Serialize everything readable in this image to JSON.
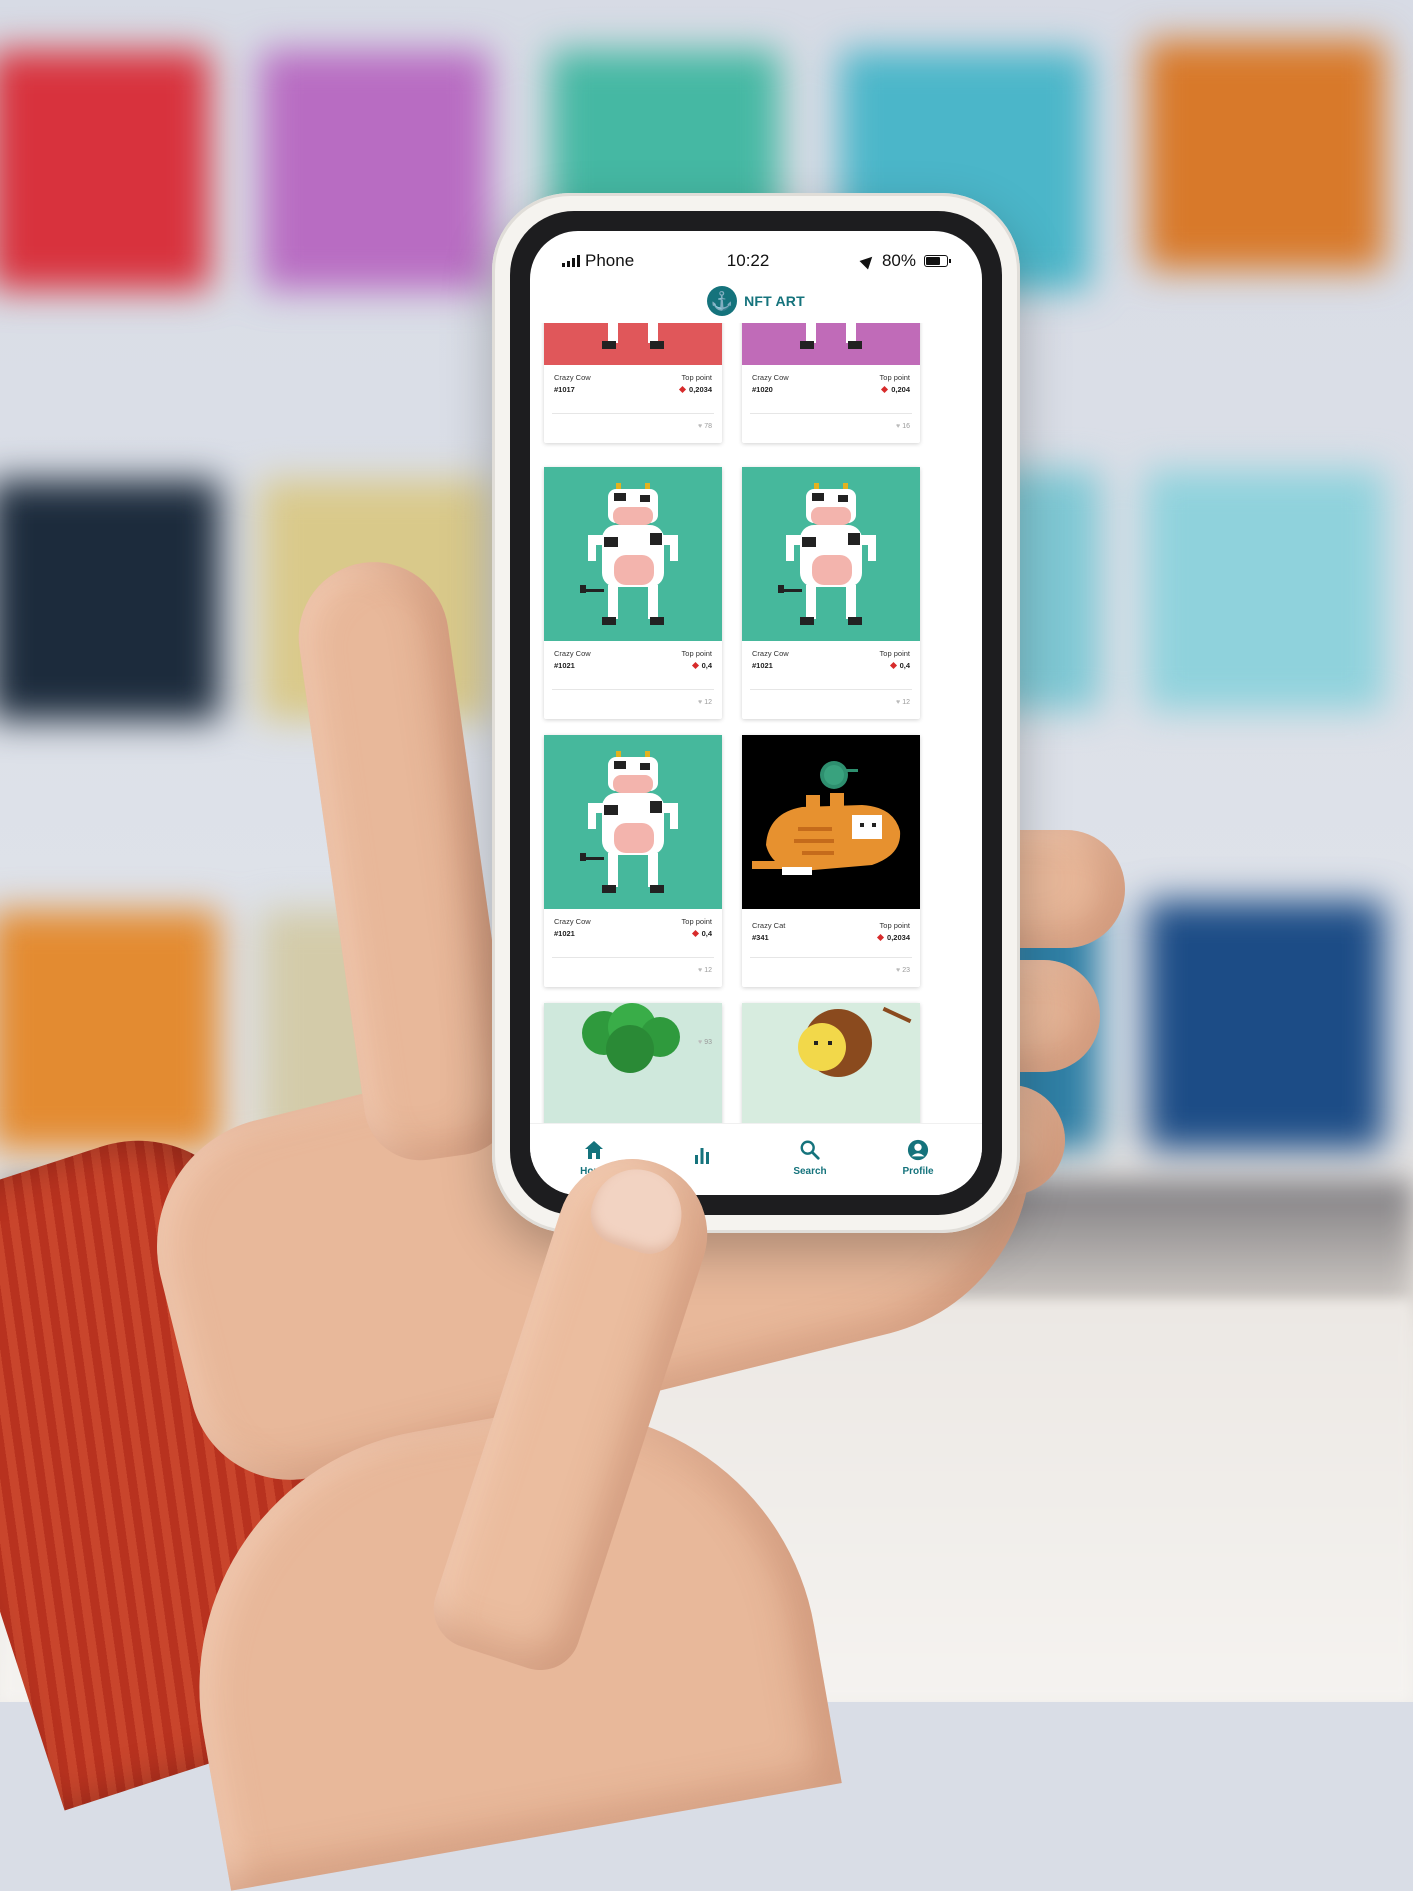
{
  "status_bar": {
    "carrier": "Phone",
    "time": "10:22",
    "battery": "80%",
    "battery_level": 0.8
  },
  "app": {
    "title": "NFT ART",
    "logo_icon": "anchor-icon",
    "brand_color": "#15737c"
  },
  "cards": [
    {
      "name": "Crazy Cow",
      "id": "#1017",
      "price_label": "Top point",
      "price": "0,2034",
      "likes": "78",
      "image": "cow-red",
      "color": "#e0575a"
    },
    {
      "name": "Crazy Cow",
      "id": "#1020",
      "price_label": "Top point",
      "price": "0,204",
      "likes": "16",
      "image": "cow-purple",
      "color": "#c06bb8"
    },
    {
      "name": "Crazy Cow",
      "id": "#1021",
      "price_label": "Top point",
      "price": "0,4",
      "likes": "12",
      "image": "cow-green",
      "color": "#46b89c"
    },
    {
      "name": "Crazy Cow",
      "id": "#1021",
      "price_label": "Top point",
      "price": "0,4",
      "likes": "12",
      "image": "cow-green",
      "color": "#46b89c"
    },
    {
      "name": "Crazy Cow",
      "id": "#1021",
      "price_label": "Top point",
      "price": "0,4",
      "likes": "12",
      "image": "cow-green",
      "color": "#46b89c"
    },
    {
      "name": "Crazy Cat",
      "id": "#341",
      "price_label": "Top point",
      "price": "0,2034",
      "likes": "23",
      "image": "cat-black",
      "color": "#000000"
    },
    {
      "name": "",
      "id": "",
      "price_label": "",
      "price": "",
      "likes": "93",
      "image": "tree",
      "color": "#cfe8dc"
    },
    {
      "name": "",
      "id": "",
      "price_label": "",
      "price": "",
      "likes": "",
      "image": "lion",
      "color": "#d7ecdf"
    }
  ],
  "nav": {
    "home": "Home",
    "stats": "",
    "search": "Search",
    "profile": "Profile"
  },
  "icons": {
    "home": "home-icon",
    "stats": "bar-chart-icon",
    "search": "search-icon",
    "profile": "profile-icon"
  }
}
